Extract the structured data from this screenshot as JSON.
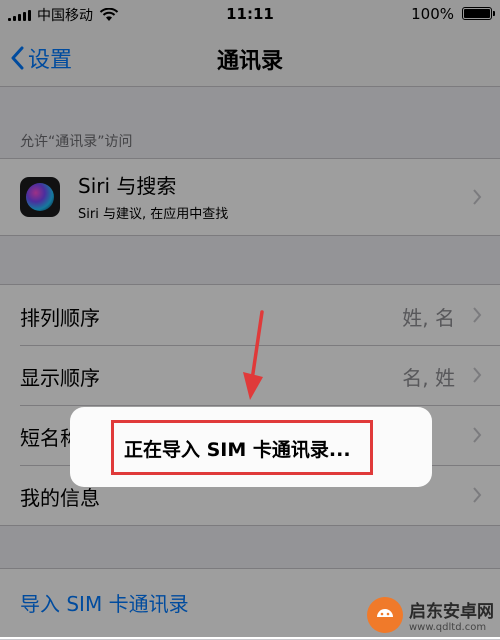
{
  "status_bar": {
    "carrier": "中国移动",
    "time": "11:11",
    "battery": "100%"
  },
  "nav": {
    "back_label": "设置",
    "title": "通讯录"
  },
  "section_header": "允许“通讯录”访问",
  "siri": {
    "title": "Siri 与搜索",
    "subtitle": "Siri 与建议, 在应用中查找"
  },
  "settings": [
    {
      "label": "排列顺序",
      "value": "姓, 名"
    },
    {
      "label": "显示顺序",
      "value": "名, 姓"
    },
    {
      "label": "短名称",
      "value": ""
    },
    {
      "label": "我的信息",
      "value": ""
    }
  ],
  "import_label": "导入 SIM 卡通讯录",
  "alert_message": "正在导入 SIM 卡通讯录...",
  "watermark": {
    "title": "启东安卓网",
    "url": "www.qdltd.com"
  },
  "colors": {
    "accent": "#007aff",
    "highlight": "#e03a3a"
  }
}
